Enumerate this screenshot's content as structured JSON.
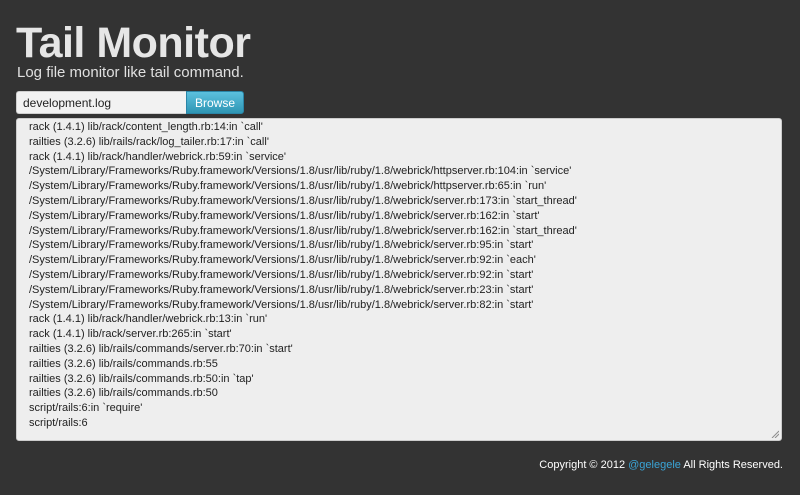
{
  "header": {
    "title": "Tail Monitor",
    "subtitle": "Log file monitor like tail command."
  },
  "file_picker": {
    "value": "development.log",
    "browse_label": "Browse"
  },
  "log": {
    "lines": [
      "rack (1.4.1) lib/rack/content_length.rb:14:in `call'",
      "railties (3.2.6) lib/rails/rack/log_tailer.rb:17:in `call'",
      "rack (1.4.1) lib/rack/handler/webrick.rb:59:in `service'",
      "/System/Library/Frameworks/Ruby.framework/Versions/1.8/usr/lib/ruby/1.8/webrick/httpserver.rb:104:in `service'",
      "/System/Library/Frameworks/Ruby.framework/Versions/1.8/usr/lib/ruby/1.8/webrick/httpserver.rb:65:in `run'",
      "/System/Library/Frameworks/Ruby.framework/Versions/1.8/usr/lib/ruby/1.8/webrick/server.rb:173:in `start_thread'",
      "/System/Library/Frameworks/Ruby.framework/Versions/1.8/usr/lib/ruby/1.8/webrick/server.rb:162:in `start'",
      "/System/Library/Frameworks/Ruby.framework/Versions/1.8/usr/lib/ruby/1.8/webrick/server.rb:162:in `start_thread'",
      "/System/Library/Frameworks/Ruby.framework/Versions/1.8/usr/lib/ruby/1.8/webrick/server.rb:95:in `start'",
      "/System/Library/Frameworks/Ruby.framework/Versions/1.8/usr/lib/ruby/1.8/webrick/server.rb:92:in `each'",
      "/System/Library/Frameworks/Ruby.framework/Versions/1.8/usr/lib/ruby/1.8/webrick/server.rb:92:in `start'",
      "/System/Library/Frameworks/Ruby.framework/Versions/1.8/usr/lib/ruby/1.8/webrick/server.rb:23:in `start'",
      "/System/Library/Frameworks/Ruby.framework/Versions/1.8/usr/lib/ruby/1.8/webrick/server.rb:82:in `start'",
      "rack (1.4.1) lib/rack/handler/webrick.rb:13:in `run'",
      "rack (1.4.1) lib/rack/server.rb:265:in `start'",
      "railties (3.2.6) lib/rails/commands/server.rb:70:in `start'",
      "railties (3.2.6) lib/rails/commands.rb:55",
      "railties (3.2.6) lib/rails/commands.rb:50:in `tap'",
      "railties (3.2.6) lib/rails/commands.rb:50",
      "script/rails:6:in `require'",
      "script/rails:6"
    ]
  },
  "footer": {
    "prefix": "Copyright © 2012 ",
    "author_link": "@gelegele",
    "suffix": " All Rights Reserved."
  },
  "colors": {
    "background": "#333333",
    "accent": "#49afcd",
    "link": "#3aa4d6"
  }
}
